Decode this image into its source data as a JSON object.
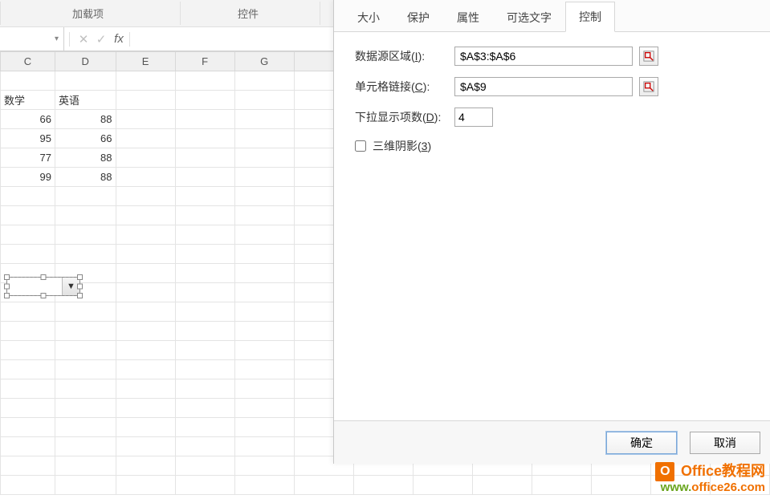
{
  "ribbon": {
    "group1": "加载项",
    "group2": "控件"
  },
  "formula_bar": {
    "name_box": "",
    "fx": "fx"
  },
  "columns": [
    "C",
    "D",
    "E",
    "F",
    "G"
  ],
  "cells": {
    "header_c": "数学",
    "header_d": "英语",
    "c1": "66",
    "d1": "88",
    "c2": "95",
    "d2": "66",
    "c3": "77",
    "d3": "88",
    "c4": "99",
    "d4": "88"
  },
  "dialog": {
    "tabs": {
      "size": "大小",
      "protect": "保护",
      "props": "属性",
      "alttext": "可选文字",
      "control": "控制"
    },
    "fields": {
      "source_label": "数据源区域(I):",
      "source_value": "$A$3:$A$6",
      "link_label": "单元格链接(C):",
      "link_value": "$A$9",
      "count_label": "下拉显示项数(D):",
      "count_value": "4",
      "shadow_label": "三维阴影(3)"
    },
    "buttons": {
      "ok": "确定",
      "cancel": "取消"
    }
  },
  "watermark": {
    "brand": "Office教程网",
    "url_www": "www.",
    "url_rest": "office26.com"
  }
}
